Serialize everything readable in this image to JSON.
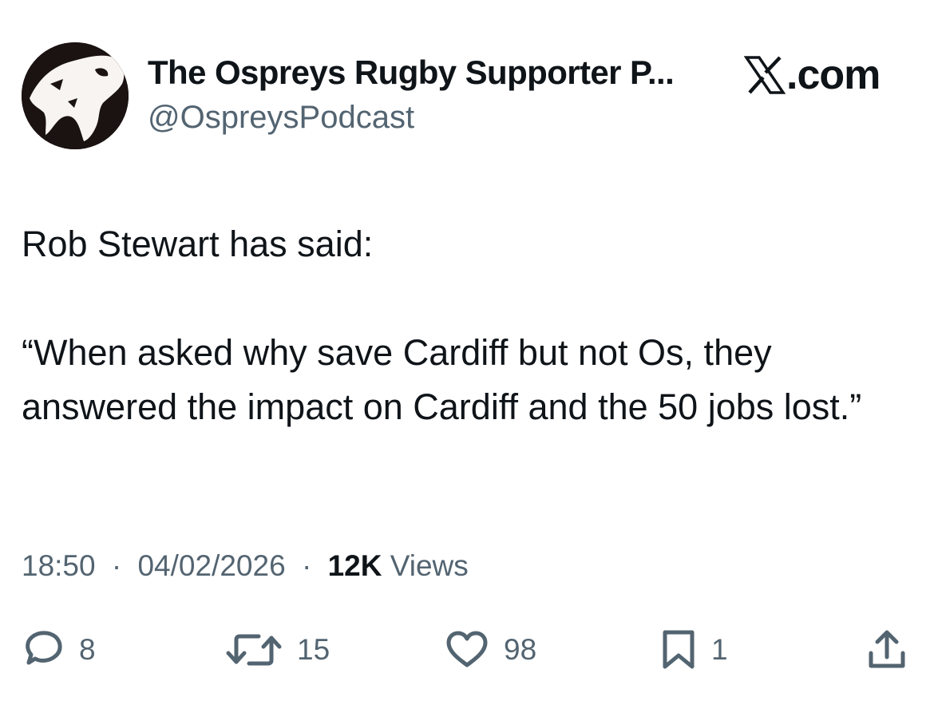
{
  "author": {
    "name": "The Ospreys Rugby Supporter P...",
    "handle": "@OspreysPodcast",
    "avatar_icon": "osprey-logo-icon"
  },
  "brand": {
    "label": ".com",
    "icon": "x-logo-icon"
  },
  "tweet": {
    "paragraphs": [
      "Rob Stewart has said:",
      "“When asked why save Cardiff but not Os, they answered the impact on Cardiff and the 50 jobs lost.”"
    ]
  },
  "meta": {
    "time": "18:50",
    "date": "04/02/2026",
    "views_count": "12K",
    "views_label": "Views",
    "separator": "·"
  },
  "actions": {
    "reply": {
      "icon": "reply-icon",
      "count": "8"
    },
    "retweet": {
      "icon": "retweet-icon",
      "count": "15"
    },
    "like": {
      "icon": "heart-icon",
      "count": "98"
    },
    "bookmark": {
      "icon": "bookmark-icon",
      "count": "1"
    },
    "share": {
      "icon": "share-icon"
    }
  },
  "colors": {
    "text_primary": "#0f1419",
    "text_secondary": "#536471",
    "background": "#ffffff"
  }
}
